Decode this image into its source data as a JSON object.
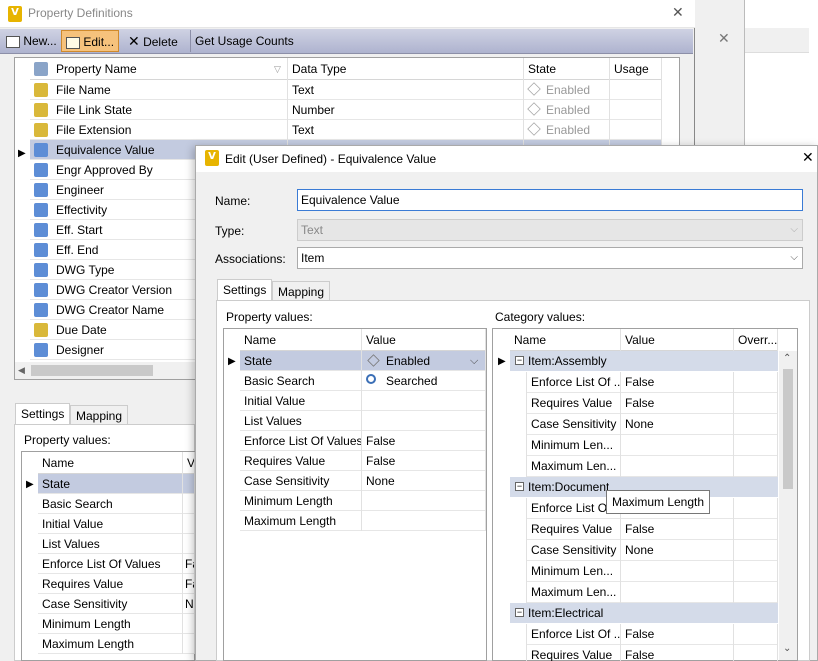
{
  "bg_window": {
    "title": "Property Definitions",
    "close_glyph": "✕",
    "toolbar": {
      "new_label": "New...",
      "edit_label": "Edit...",
      "delete_label": "Delete",
      "usage_label": "Get Usage Counts"
    },
    "grid": {
      "headers": [
        "Property Name",
        "Data Type",
        "State",
        "Usage"
      ],
      "rows": [
        {
          "name": "File Name",
          "type": "Text",
          "state": "Enabled"
        },
        {
          "name": "File Link State",
          "type": "Number",
          "state": "Enabled"
        },
        {
          "name": "File Extension",
          "type": "Text",
          "state": "Enabled"
        },
        {
          "name": "Equivalence Value",
          "type": "",
          "state": ""
        },
        {
          "name": "Engr Approved By",
          "type": "",
          "state": ""
        },
        {
          "name": "Engineer",
          "type": "",
          "state": ""
        },
        {
          "name": "Effectivity",
          "type": "",
          "state": ""
        },
        {
          "name": "Eff. Start",
          "type": "",
          "state": ""
        },
        {
          "name": "Eff. End",
          "type": "",
          "state": ""
        },
        {
          "name": "DWG Type",
          "type": "",
          "state": ""
        },
        {
          "name": "DWG Creator Version",
          "type": "",
          "state": ""
        },
        {
          "name": "DWG Creator Name",
          "type": "",
          "state": ""
        },
        {
          "name": "Due Date",
          "type": "",
          "state": ""
        },
        {
          "name": "Designer",
          "type": "",
          "state": ""
        }
      ]
    },
    "tabs": [
      "Settings",
      "Mapping"
    ],
    "property_values_label": "Property values:",
    "pv_header": [
      "Name",
      "Va"
    ],
    "pv_rows": [
      {
        "name": "State",
        "value": ""
      },
      {
        "name": "Basic Search",
        "value": ""
      },
      {
        "name": "Initial Value",
        "value": ""
      },
      {
        "name": "List Values",
        "value": ""
      },
      {
        "name": "Enforce List Of Values",
        "value": "Fa"
      },
      {
        "name": "Requires Value",
        "value": "Fa"
      },
      {
        "name": "Case Sensitivity",
        "value": "N"
      },
      {
        "name": "Minimum Length",
        "value": ""
      },
      {
        "name": "Maximum Length",
        "value": ""
      }
    ]
  },
  "side_close_glyph": "✕",
  "dialog": {
    "title": "Edit (User Defined) - Equivalence Value",
    "close_glyph": "✕",
    "name_label": "Name:",
    "name_value": "Equivalence Value",
    "type_label": "Type:",
    "type_value": "Text",
    "assoc_label": "Associations:",
    "assoc_value": "Item",
    "tabs": [
      "Settings",
      "Mapping"
    ],
    "property_values_label": "Property values:",
    "category_values_label": "Category values:",
    "pv_header": [
      "Name",
      "Value"
    ],
    "pv_rows": [
      {
        "name": "State",
        "value": "Enabled"
      },
      {
        "name": "Basic Search",
        "value": "Searched"
      },
      {
        "name": "Initial Value",
        "value": ""
      },
      {
        "name": "List Values",
        "value": ""
      },
      {
        "name": "Enforce List Of Values",
        "value": "False"
      },
      {
        "name": "Requires Value",
        "value": "False"
      },
      {
        "name": "Case Sensitivity",
        "value": "None"
      },
      {
        "name": "Minimum Length",
        "value": ""
      },
      {
        "name": "Maximum Length",
        "value": ""
      }
    ],
    "cat_header": [
      "Name",
      "Value",
      "Overr..."
    ],
    "categories": [
      {
        "group": "Item:Assembly",
        "rows": [
          {
            "name": "Enforce List Of ...",
            "value": "False"
          },
          {
            "name": "Requires Value",
            "value": "False"
          },
          {
            "name": "Case Sensitivity",
            "value": "None"
          },
          {
            "name": "Minimum Len...",
            "value": ""
          },
          {
            "name": "Maximum Len...",
            "value": ""
          }
        ]
      },
      {
        "group": "Item:Document",
        "rows": [
          {
            "name": "Enforce List Of",
            "value": ""
          },
          {
            "name": "Requires Value",
            "value": "False"
          },
          {
            "name": "Case Sensitivity",
            "value": "None"
          },
          {
            "name": "Minimum Len...",
            "value": ""
          },
          {
            "name": "Maximum Len...",
            "value": ""
          }
        ]
      },
      {
        "group": "Item:Electrical",
        "rows": [
          {
            "name": "Enforce List Of ...",
            "value": "False"
          },
          {
            "name": "Requires Value",
            "value": "False"
          }
        ]
      }
    ],
    "tooltip": "Maximum Length"
  }
}
